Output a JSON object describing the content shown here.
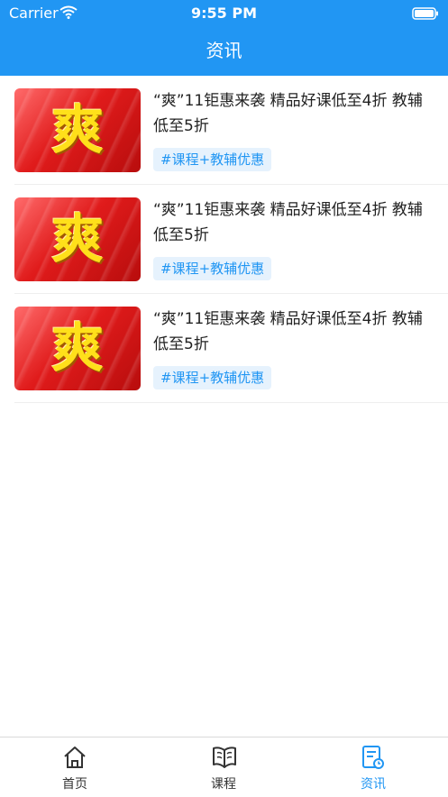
{
  "status_bar": {
    "carrier": "Carrier",
    "time": "9:55 PM"
  },
  "header": {
    "title": "资讯"
  },
  "news": [
    {
      "image_text": "爽",
      "title": "“爽”11钜惠来袭 精品好课低至4折 教辅低至5折",
      "tag": "#课程+教辅优惠"
    },
    {
      "image_text": "爽",
      "title": "“爽”11钜惠来袭 精品好课低至4折 教辅低至5折",
      "tag": "#课程+教辅优惠"
    },
    {
      "image_text": "爽",
      "title": "“爽”11钜惠来袭 精品好课低至4折 教辅低至5折",
      "tag": "#课程+教辅优惠"
    }
  ],
  "tabs": [
    {
      "label": "首页",
      "icon": "home-icon",
      "active": false
    },
    {
      "label": "课程",
      "icon": "book-icon",
      "active": false
    },
    {
      "label": "资讯",
      "icon": "news-icon",
      "active": true
    }
  ],
  "colors": {
    "accent": "#2196F3",
    "tag_bg": "#e6f2fd",
    "thumb_red": "#e01b1b",
    "thumb_text": "#ffe01a"
  }
}
